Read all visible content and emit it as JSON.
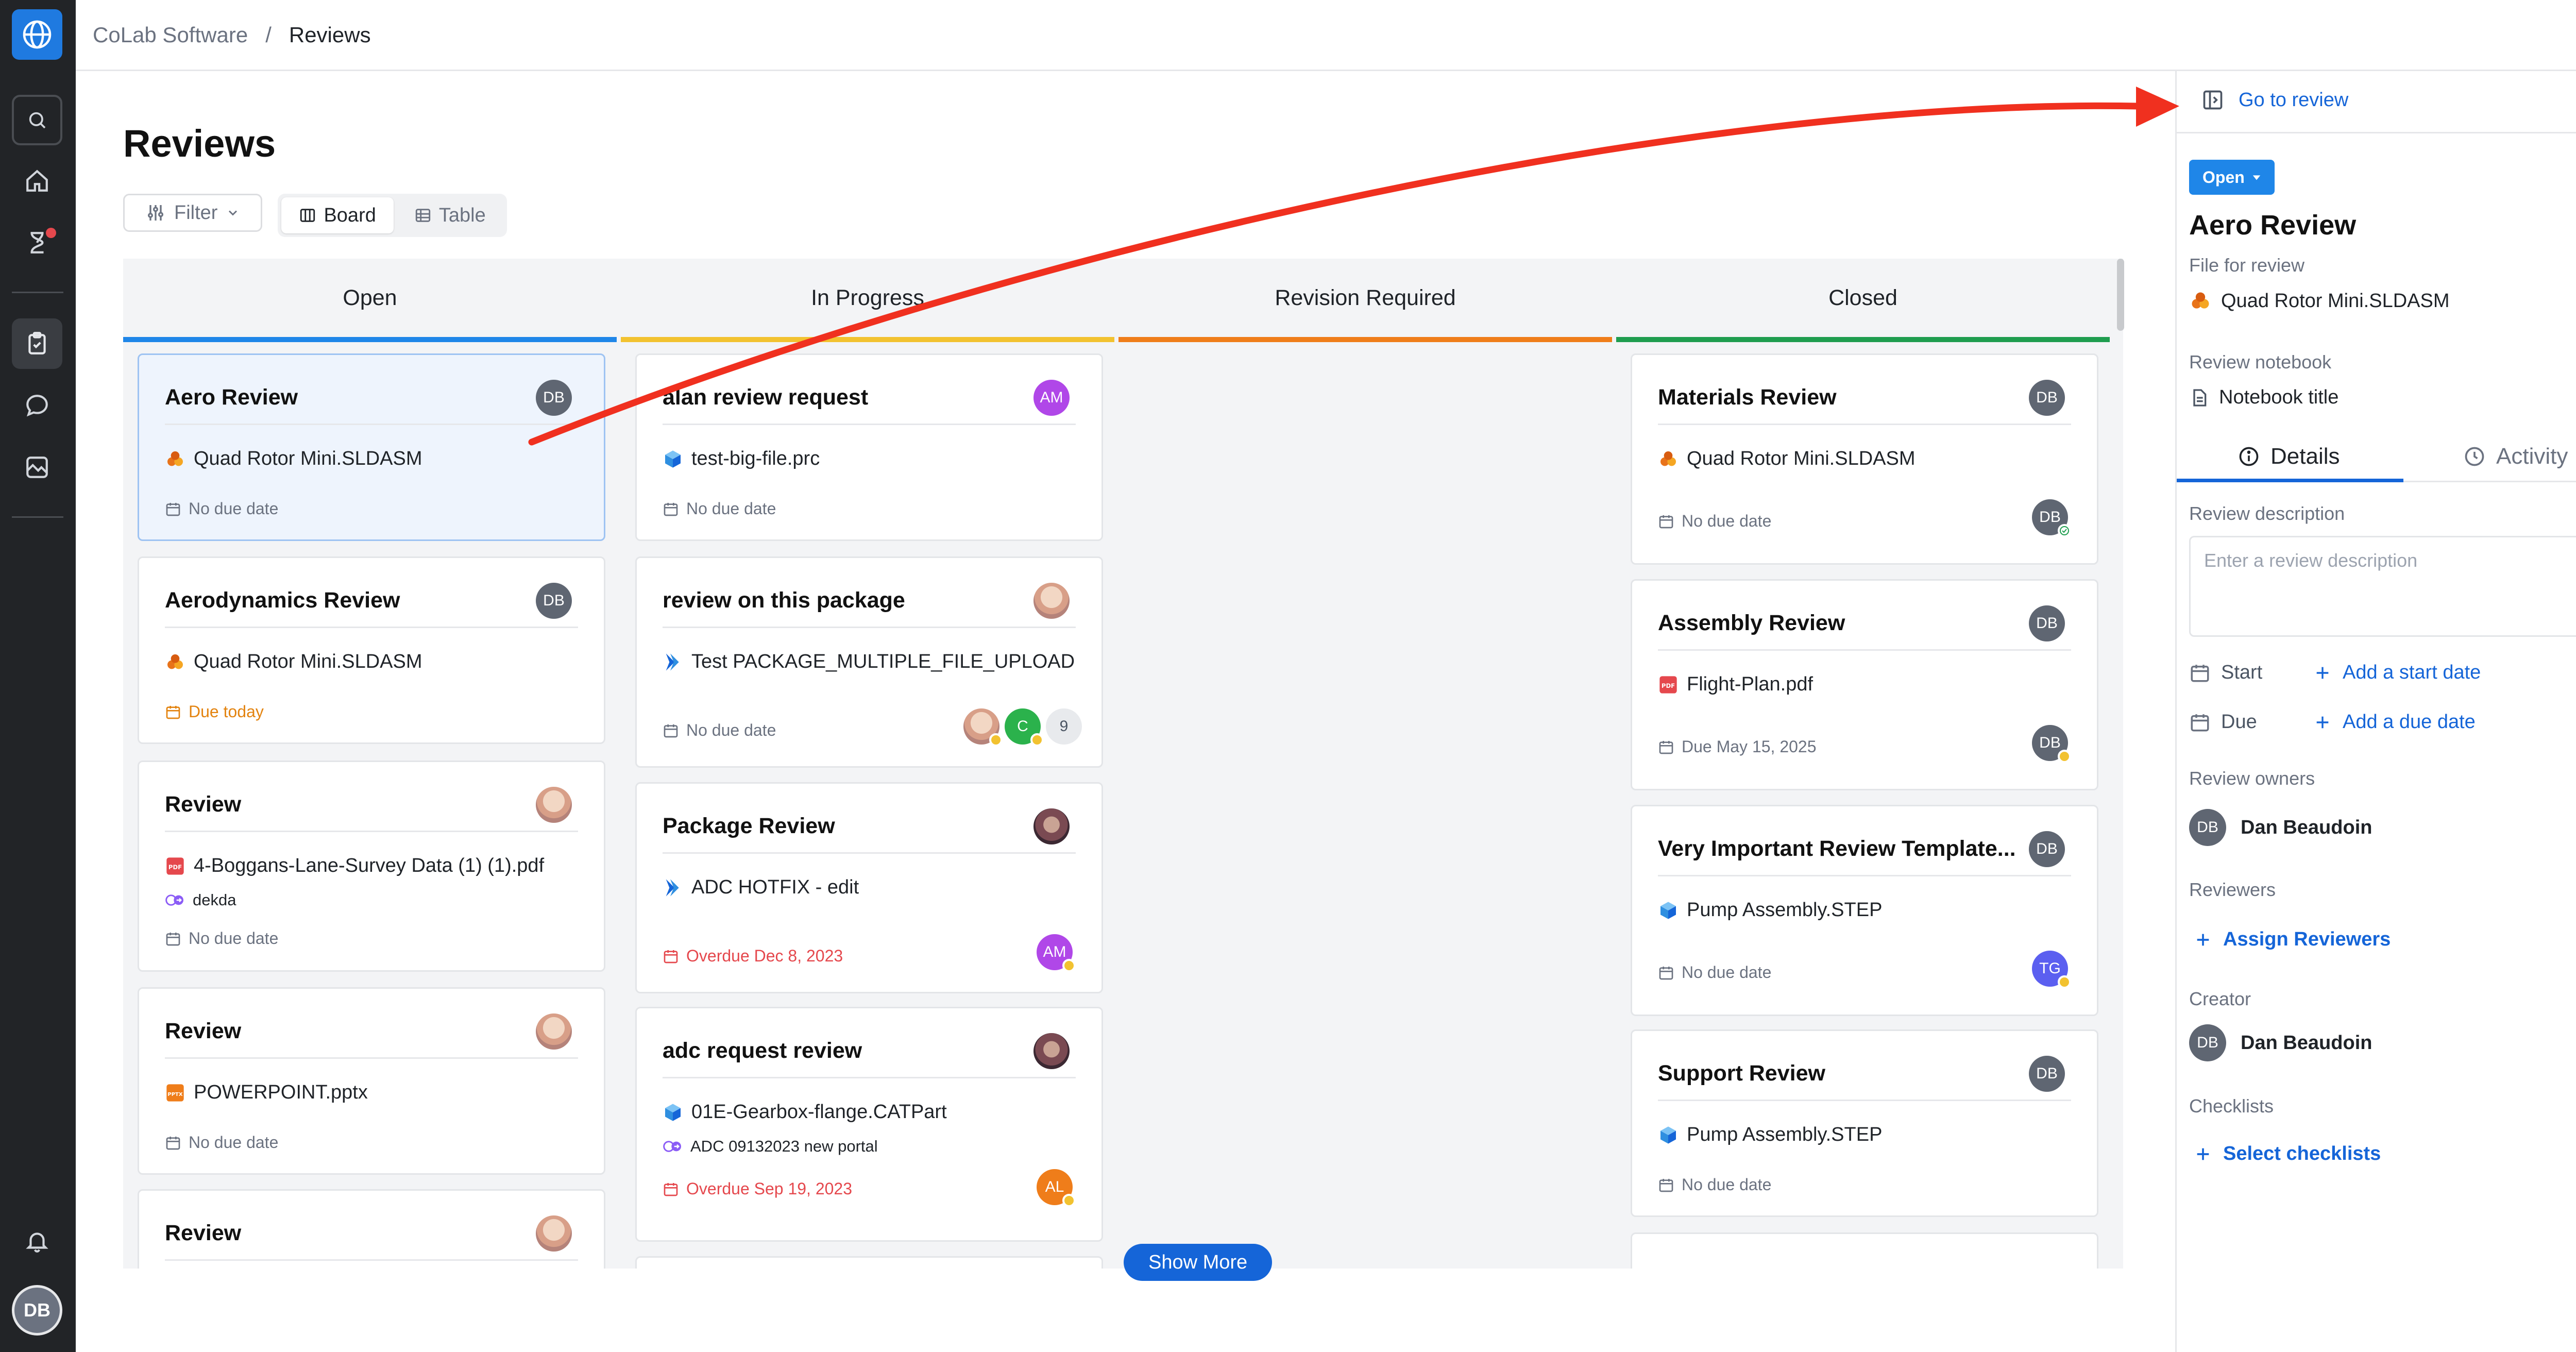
{
  "breadcrumb": {
    "org": "CoLab Software",
    "separator": "/",
    "current": "Reviews"
  },
  "page": {
    "title": "Reviews"
  },
  "toolbar": {
    "filter": "Filter",
    "board": "Board",
    "table": "Table"
  },
  "columns": [
    {
      "name": "Open",
      "color": "#1f86e8"
    },
    {
      "name": "In Progress",
      "color": "#f2c230"
    },
    {
      "name": "Revision Required",
      "color": "#ef7d1a"
    },
    {
      "name": "Closed",
      "color": "#1f9d4f"
    }
  ],
  "open_cards": [
    {
      "title": "Aero Review",
      "file": "Quad Rotor Mini.SLDASM",
      "date": "No due date",
      "owner": "DB"
    },
    {
      "title": "Aerodynamics Review",
      "file": "Quad Rotor Mini.SLDASM",
      "date": "Due today",
      "owner": "DB"
    },
    {
      "title": "Review",
      "file": "4-Boggans-Lane-Survey Data (1) (1).pdf",
      "sub": "dekda",
      "date": "No due date"
    },
    {
      "title": "Review",
      "file": "POWERPOINT.pptx",
      "date": "No due date"
    },
    {
      "title": "Review"
    }
  ],
  "progress_cards": [
    {
      "title": "alan review request",
      "file": "test-big-file.prc",
      "date": "No due date",
      "owner": "AM"
    },
    {
      "title": "review on this package",
      "file": "Test PACKAGE_MULTIPLE_FILE_UPLOAD",
      "date": "No due date",
      "reviewer_c": "C",
      "reviewer_count": "9"
    },
    {
      "title": "Package Review",
      "file": "ADC HOTFIX - edit",
      "date": "Overdue Dec 8, 2023",
      "reviewer": "AM"
    },
    {
      "title": "adc request review",
      "file": "01E-Gearbox-flange.CATPart",
      "sub": "ADC 09132023 new portal",
      "date": "Overdue Sep 19, 2023",
      "reviewer": "AL"
    }
  ],
  "closed_cards": [
    {
      "title": "Materials Review",
      "file": "Quad Rotor Mini.SLDASM",
      "date": "No due date",
      "owner": "DB",
      "reviewer": "DB"
    },
    {
      "title": "Assembly Review",
      "file": "Flight-Plan.pdf",
      "date": "Due May 15, 2025",
      "owner": "DB",
      "reviewer": "DB"
    },
    {
      "title": "Very Important Review Template...",
      "file": "Pump Assembly.STEP",
      "date": "No due date",
      "owner": "DB",
      "reviewer": "TG"
    },
    {
      "title": "Support Review",
      "file": "Pump Assembly.STEP",
      "date": "No due date",
      "owner": "DB"
    }
  ],
  "show_more": "Show More",
  "panel": {
    "go_to_review": "Go to review",
    "more": "⋮",
    "status": "Open",
    "title": "Aero Review",
    "file_label": "File for review",
    "file": "Quad Rotor Mini.SLDASM",
    "notebook_label": "Review notebook",
    "notebook": "Notebook title",
    "tab_details": "Details",
    "tab_activity": "Activity",
    "desc_label": "Review description",
    "desc_placeholder": "Enter a review description",
    "start_label": "Start",
    "start_action": "Add a start date",
    "due_label": "Due",
    "due_action": "Add a due date",
    "owners_label": "Review owners",
    "owner_initials": "DB",
    "owner_name": "Dan Beaudoin",
    "reviewers_label": "Reviewers",
    "assign_reviewers": "Assign Reviewers",
    "creator_label": "Creator",
    "creator_initials": "DB",
    "creator_name": "Dan Beaudoin",
    "checklists_label": "Checklists",
    "select_checklists": "Select checklists"
  },
  "user": {
    "initials": "DB"
  },
  "colors": {
    "accent": "#1565d8",
    "arrow": "#f0301f"
  }
}
